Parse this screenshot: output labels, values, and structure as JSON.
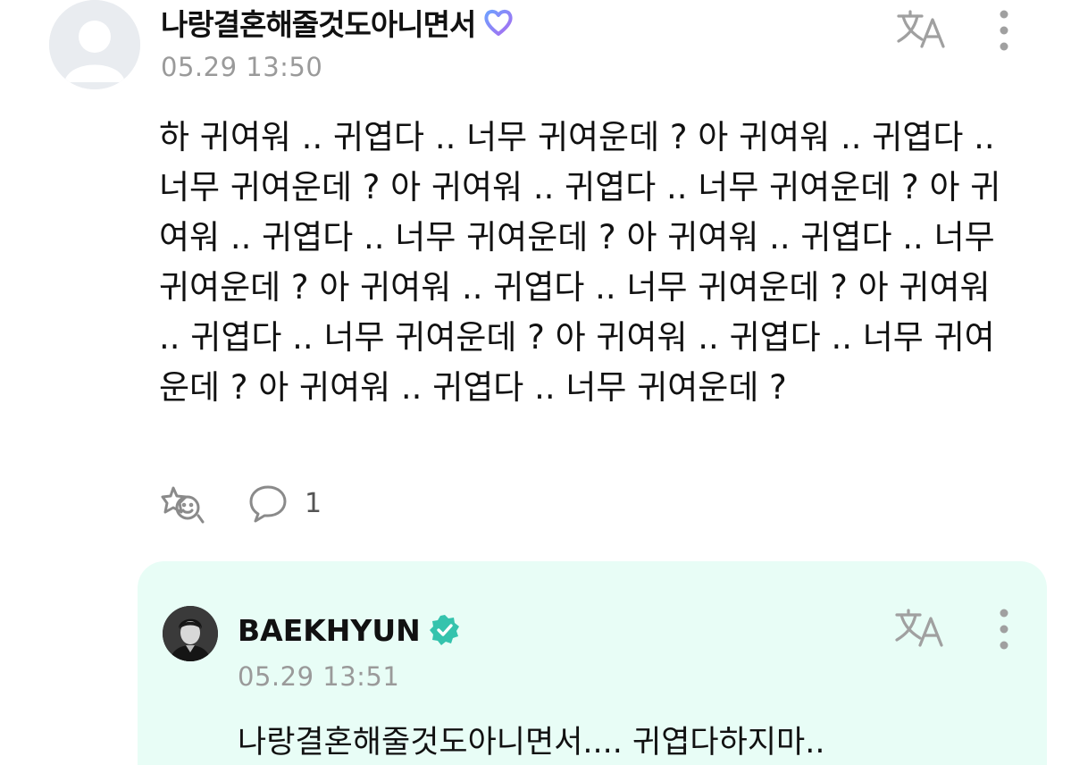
{
  "post": {
    "author": {
      "name": "나랑결혼해줄것도아니면서",
      "avatar_icon": "default-user-avatar",
      "badge_icon": "purple-heart-icon",
      "badge_color": "#8a6cf0"
    },
    "timestamp": "05.29 13:50",
    "body": "하 귀여워 .. 귀엽다 .. 너무 귀여운데 ? 아 귀여워 .. 귀엽다 .. 너무 귀여운데 ? 아 귀여워 .. 귀엽다 .. 너무 귀여운데 ? 아 귀여워 .. 귀엽다 .. 너무 귀여운데 ? 아 귀여워 .. 귀엽다 .. 너무 귀여운데 ? 아 귀여워 .. 귀엽다 .. 너무 귀여운데 ? 아 귀여워 .. 귀엽다 .. 너무 귀여운데 ? 아 귀여워 .. 귀엽다 .. 너무 귀여운데 ? 아 귀여워 .. 귀엽다 .. 너무 귀여운데 ?",
    "actions": {
      "reaction_icon": "add-reaction-icon",
      "comment_icon": "comment-bubble-icon",
      "comment_count": "1"
    },
    "toolbar": {
      "translate_icon": "translate-icon",
      "more_icon": "more-vertical-icon"
    }
  },
  "reply": {
    "author": {
      "name": "BAEKHYUN",
      "avatar_icon": "artist-avatar",
      "badge_icon": "verified-badge-icon",
      "badge_color": "#35c3ad"
    },
    "timestamp": "05.29 13:51",
    "body": "나랑결혼해줄것도아니면서.... 귀엽다하지마..",
    "background_color": "#e8fdf6",
    "toolbar": {
      "translate_icon": "translate-icon",
      "more_icon": "more-vertical-icon"
    }
  },
  "colors": {
    "text_primary": "#111111",
    "text_secondary": "#9a9a9a",
    "icon_gray": "#a0a0a0"
  }
}
